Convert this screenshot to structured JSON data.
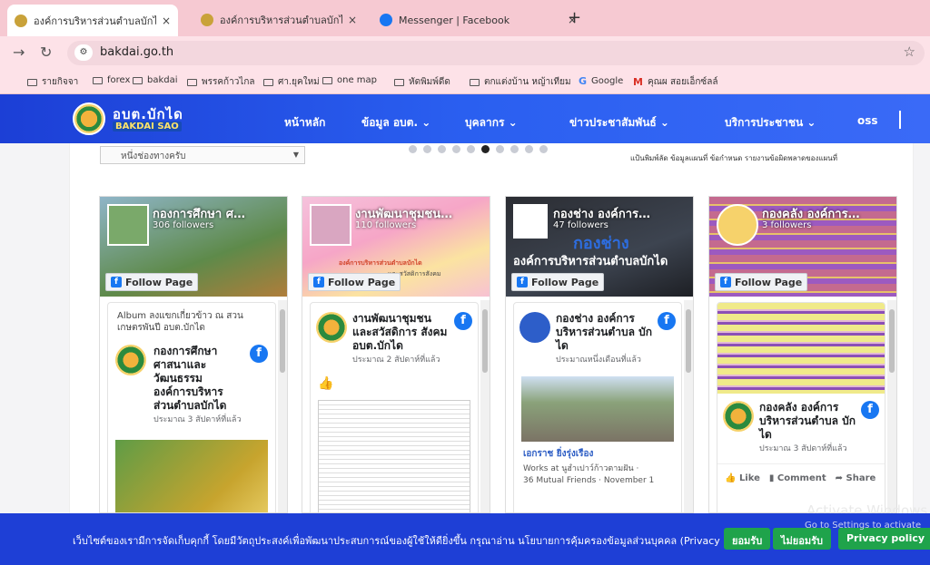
{
  "browser": {
    "tabs": [
      {
        "title": "องค์การบริหารส่วนตำบลบักได – อบต.",
        "active": true,
        "fav_color": "#c9a23a"
      },
      {
        "title": "องค์การบริหารส่วนตำบลบักได – อบต.",
        "active": false,
        "fav_color": "#c9a23a"
      },
      {
        "title": "Messenger | Facebook",
        "active": false,
        "fav_color": "#1877f2"
      }
    ],
    "close_glyph": "×",
    "new_tab_glyph": "+",
    "url": "bakdai.go.th",
    "bookmarks": [
      {
        "label": "รายกิจจา",
        "type": "folder"
      },
      {
        "label": "forex",
        "type": "folder"
      },
      {
        "label": "bakdai",
        "type": "folder"
      },
      {
        "label": "พรรคก้าวไกล",
        "type": "folder"
      },
      {
        "label": "ศา.ยุคใหม่",
        "type": "folder"
      },
      {
        "label": "one map",
        "type": "folder"
      },
      {
        "label": "หัดพิมพ์ดีด",
        "type": "folder"
      },
      {
        "label": "ตกแต่งบ้าน หญ้าเทียม",
        "type": "folder"
      },
      {
        "label": "Google",
        "type": "google"
      },
      {
        "label": "คุณผ สอยเอ็กซ์ลล์",
        "type": "gmail"
      }
    ]
  },
  "site": {
    "brand_th": "อบต.บักได",
    "brand_en": "BAKDAI SAO",
    "menu": [
      "หน้าหลัก",
      "ข้อมูล อบต. ⌄",
      "บุคลากร ⌄",
      "ข่าวประชาสัมพันธ์ ⌄",
      "บริการประชาชน ⌄",
      "oss"
    ],
    "select_placeholder": "หนึ่งช่องทางครับ",
    "mini_links": "แป้นพิมพ์ลัด   ข้อมูลแผนที่   ข้อกำหนด   รายงานข้อผิดพลาดของแผนที่"
  },
  "cards": [
    {
      "page_name": "กองการศึกษา ศ…",
      "followers": "306 followers",
      "follow_label": "Follow Page",
      "album_text": "Album ลงแขกเกี่ยวข้าว ณ สวนเกษตรพันปี อบต.บักได",
      "post_author": "กองการศึกษา ศาสนาและ วัฒนธรรม องค์การบริหาร ส่วนตำบลบักได",
      "post_time": "ประมาณ 3 สัปดาห์ที่แล้ว"
    },
    {
      "page_name": "งานพัฒนาชุมชน…",
      "followers": "110 followers",
      "follow_label": "Follow Page",
      "cover_text": "องค์การบริหารส่วนตำบลบักได",
      "cover_sub": "และสวัสดิการสังคม",
      "post_author": "งานพัฒนาชุมชน และสวัสดิการ สังคม อบต.บักได",
      "post_time": "ประมาณ 2 สัปดาห์ที่แล้ว",
      "emoji": "👍"
    },
    {
      "page_name": "กองช่าง องค์การ…",
      "followers": "47 followers",
      "follow_label": "Follow Page",
      "cover_title": "กองช่าง",
      "cover_sub": "องค์การบริหารส่วนตำบลบักได",
      "post_author": "กองช่าง องค์การ บริหารส่วนตำบล บักได",
      "post_time": "ประมาณหนึ่งเดือนที่แล้ว",
      "shared_name": "เอกราช ยิ่งรุ่งเรือง",
      "shared_work": "Works at นูฮำเปาว์ก้าวตามฝัน ·",
      "shared_info": "36 Mutual Friends · November 1"
    },
    {
      "page_name": "กองคลัง องค์การ…",
      "followers": "3 followers",
      "follow_label": "Follow Page",
      "post_author": "กองคลัง องค์การ บริหารส่วนตำบล บักได",
      "post_time": "ประมาณ 3 สัปดาห์ที่แล้ว",
      "like": "Like",
      "comment": "Comment",
      "share": "Share"
    }
  ],
  "cookie": {
    "text": "เว็บไซต์ของเรามีการจัดเก็บคุกกี้ โดยมีวัตถุประสงค์เพื่อพัฒนาประสบการณ์ของผู้ใช้ให้ดียิ่งขึ้น กรุณาอ่าน นโยบายการคุ้มครองข้อมูลส่วนบุคคล (Privacy Policy)",
    "accept": "ยอมรับ",
    "decline": "ไม่ยอมรับ",
    "policy": "Privacy policy"
  },
  "watermark": {
    "line1": "Activate Windows",
    "line2": "Go to Settings to activate"
  }
}
